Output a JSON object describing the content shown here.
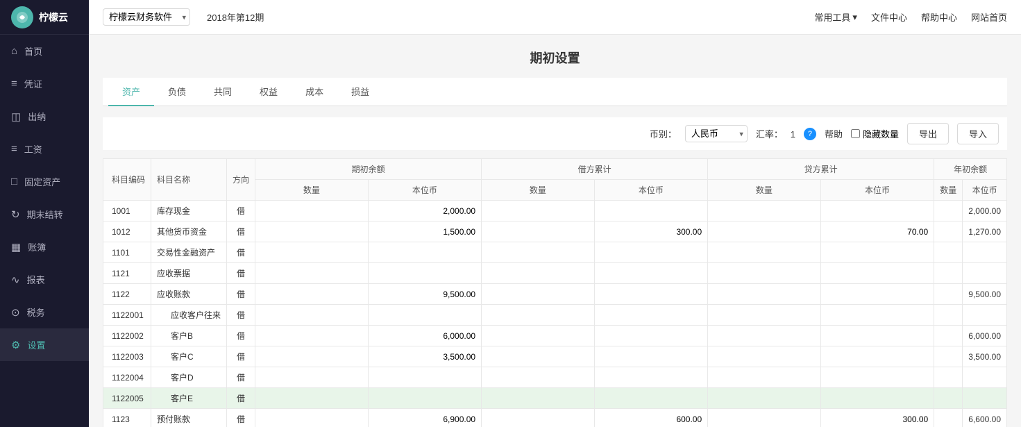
{
  "app": {
    "logo_text": "柠檬云",
    "company_select": "柠檬云财务软件",
    "period": "2018年第12期",
    "header_tools": [
      {
        "label": "常用工具",
        "has_arrow": true
      },
      {
        "label": "文件中心"
      },
      {
        "label": "帮助中心"
      },
      {
        "label": "网站首页"
      }
    ]
  },
  "sidebar": {
    "items": [
      {
        "id": "home",
        "label": "首页",
        "icon": "⌂"
      },
      {
        "id": "voucher",
        "label": "凭证",
        "icon": "≡"
      },
      {
        "id": "cashier",
        "label": "出纳",
        "icon": "💳"
      },
      {
        "id": "salary",
        "label": "工资",
        "icon": "≡"
      },
      {
        "id": "fixed-assets",
        "label": "固定资产",
        "icon": "□"
      },
      {
        "id": "period-end",
        "label": "期末结转",
        "icon": "↻"
      },
      {
        "id": "ledger",
        "label": "账簿",
        "icon": "📖"
      },
      {
        "id": "report",
        "label": "报表",
        "icon": "📈"
      },
      {
        "id": "tax",
        "label": "税务",
        "icon": "⊙"
      },
      {
        "id": "settings",
        "label": "设置",
        "icon": "⚙",
        "active": true
      }
    ]
  },
  "page": {
    "title": "期初设置",
    "tabs": [
      {
        "id": "assets",
        "label": "资产",
        "active": true
      },
      {
        "id": "liabilities",
        "label": "负债"
      },
      {
        "id": "common",
        "label": "共同"
      },
      {
        "id": "equity",
        "label": "权益"
      },
      {
        "id": "cost",
        "label": "成本"
      },
      {
        "id": "profit",
        "label": "损益"
      }
    ],
    "toolbar": {
      "currency_label": "币别：",
      "currency_value": "人民币",
      "rate_label": "汇率：",
      "rate_value": "1",
      "help_label": "帮助",
      "hide_qty_label": "隐藏数量",
      "export_label": "导出",
      "import_label": "导入"
    },
    "table": {
      "headers": {
        "code": "科目编码",
        "name": "科目名称",
        "direction": "方向",
        "opening_balance": "期初余额",
        "debit_cumulative": "借方累计",
        "credit_cumulative": "贷方累计",
        "year_opening": "年初余额",
        "qty": "数量",
        "local": "本位币",
        "qty2": "数量",
        "local2": "本位币",
        "qty3": "数量",
        "local3": "本位币",
        "qty4": "数量",
        "local4": "本位币"
      },
      "rows": [
        {
          "code": "1001",
          "name": "库存现金",
          "dir": "借",
          "ob_qty": "",
          "ob_local": "2,000.00",
          "dc_qty": "",
          "dc_local": "",
          "cc_qty": "",
          "cc_local": "",
          "yo_qty": "",
          "yo_local": "2,000.00",
          "highlight": false,
          "indent": false
        },
        {
          "code": "1012",
          "name": "其他货币资金",
          "dir": "借",
          "ob_qty": "",
          "ob_local": "1,500.00",
          "dc_qty": "",
          "dc_local": "300.00",
          "cc_qty": "",
          "cc_local": "70.00",
          "yo_qty": "",
          "yo_local": "1,270.00",
          "highlight": false,
          "indent": false
        },
        {
          "code": "1101",
          "name": "交易性金融资产",
          "dir": "借",
          "ob_qty": "",
          "ob_local": "",
          "dc_qty": "",
          "dc_local": "",
          "cc_qty": "",
          "cc_local": "",
          "yo_qty": "",
          "yo_local": "",
          "highlight": false,
          "indent": false
        },
        {
          "code": "1121",
          "name": "应收票据",
          "dir": "借",
          "ob_qty": "",
          "ob_local": "",
          "dc_qty": "",
          "dc_local": "",
          "cc_qty": "",
          "cc_local": "",
          "yo_qty": "",
          "yo_local": "",
          "highlight": false,
          "indent": false
        },
        {
          "code": "1122",
          "name": "应收账款",
          "dir": "借",
          "ob_qty": "",
          "ob_local": "9,500.00",
          "dc_qty": "",
          "dc_local": "",
          "cc_qty": "",
          "cc_local": "",
          "yo_qty": "",
          "yo_local": "9,500.00",
          "highlight": false,
          "indent": false
        },
        {
          "code": "1122001",
          "name": "应收客户往来",
          "dir": "借",
          "ob_qty": "",
          "ob_local": "",
          "dc_qty": "",
          "dc_local": "",
          "cc_qty": "",
          "cc_local": "",
          "yo_qty": "",
          "yo_local": "",
          "highlight": false,
          "indent": true
        },
        {
          "code": "1122002",
          "name": "客户B",
          "dir": "借",
          "ob_qty": "",
          "ob_local": "6,000.00",
          "dc_qty": "",
          "dc_local": "",
          "cc_qty": "",
          "cc_local": "",
          "yo_qty": "",
          "yo_local": "6,000.00",
          "highlight": false,
          "indent": true
        },
        {
          "code": "1122003",
          "name": "客户C",
          "dir": "借",
          "ob_qty": "",
          "ob_local": "3,500.00",
          "dc_qty": "",
          "dc_local": "",
          "cc_qty": "",
          "cc_local": "",
          "yo_qty": "",
          "yo_local": "3,500.00",
          "highlight": false,
          "indent": true
        },
        {
          "code": "1122004",
          "name": "客户D",
          "dir": "借",
          "ob_qty": "",
          "ob_local": "",
          "dc_qty": "",
          "dc_local": "",
          "cc_qty": "",
          "cc_local": "",
          "yo_qty": "",
          "yo_local": "",
          "highlight": false,
          "indent": true
        },
        {
          "code": "1122005",
          "name": "客户E",
          "dir": "借",
          "ob_qty": "",
          "ob_local": "",
          "dc_qty": "",
          "dc_local": "",
          "cc_qty": "",
          "cc_local": "",
          "yo_qty": "",
          "yo_local": "",
          "highlight": true,
          "indent": true
        },
        {
          "code": "1123",
          "name": "预付账款",
          "dir": "借",
          "ob_qty": "",
          "ob_local": "6,900.00",
          "dc_qty": "",
          "dc_local": "600.00",
          "cc_qty": "",
          "cc_local": "300.00",
          "yo_qty": "",
          "yo_local": "6,600.00",
          "highlight": false,
          "indent": false
        }
      ]
    }
  },
  "colors": {
    "accent": "#4db6ac",
    "sidebar_bg": "#1e2030",
    "highlight_row": "#e8f5e9",
    "active_nav": "#2a2a3e"
  }
}
